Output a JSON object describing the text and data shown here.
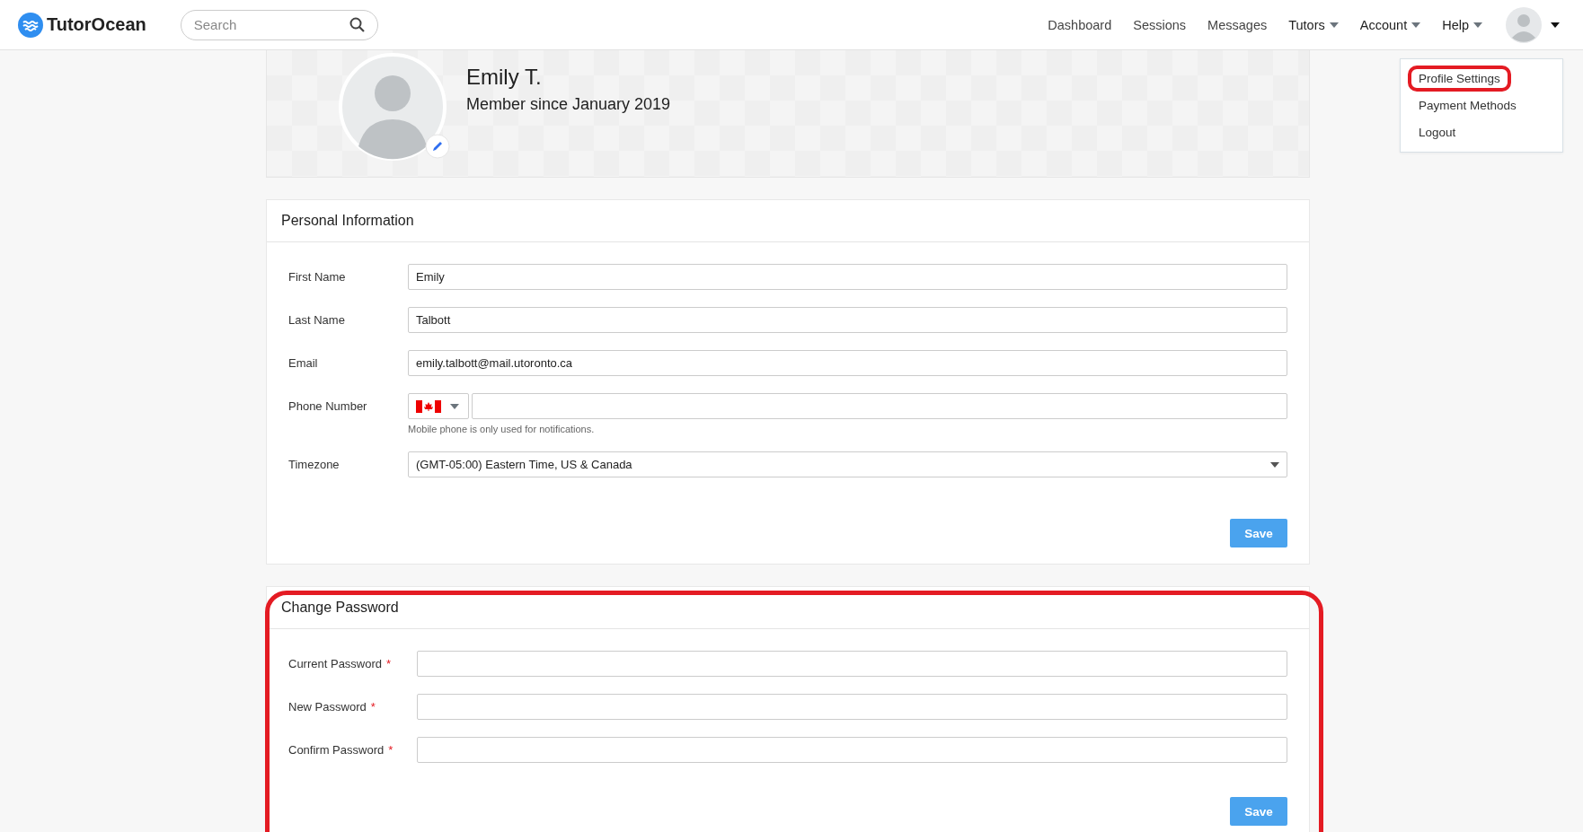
{
  "header": {
    "logo": "TutorOcean",
    "search": {
      "placeholder": "Search"
    },
    "nav": [
      {
        "label": "Dashboard",
        "dropdown": false
      },
      {
        "label": "Sessions",
        "dropdown": false
      },
      {
        "label": "Messages",
        "dropdown": false
      },
      {
        "label": "Tutors",
        "dropdown": true
      },
      {
        "label": "Account",
        "dropdown": true
      },
      {
        "label": "Help",
        "dropdown": true
      }
    ]
  },
  "user_menu": {
    "items": [
      {
        "label": "Profile Settings",
        "highlighted": true
      },
      {
        "label": "Payment Methods",
        "highlighted": false
      },
      {
        "label": "Logout",
        "highlighted": false
      }
    ]
  },
  "profile": {
    "name": "Emily T.",
    "member_since": "Member since January 2019"
  },
  "personal_information": {
    "title": "Personal Information",
    "highlighted": false,
    "fields": [
      {
        "kind": "text",
        "label": "First Name",
        "value": "Emily"
      },
      {
        "kind": "text",
        "label": "Last Name",
        "value": "Talbott"
      },
      {
        "kind": "text",
        "label": "Email",
        "value": "emily.talbott@mail.utoronto.ca"
      },
      {
        "kind": "phone",
        "label": "Phone Number",
        "hint": "Mobile phone is only used for notifications."
      },
      {
        "kind": "select",
        "label": "Timezone",
        "value": "(GMT-05:00) Eastern Time, US & Canada"
      }
    ],
    "button": "Save"
  },
  "change_password": {
    "title": "Change Password",
    "highlighted": true,
    "fields": [
      {
        "label": "Current Password",
        "required_mark": "*"
      },
      {
        "label": "New Password",
        "required_mark": "*"
      },
      {
        "label": "Confirm Password",
        "required_mark": "*"
      }
    ],
    "button": "Save"
  }
}
